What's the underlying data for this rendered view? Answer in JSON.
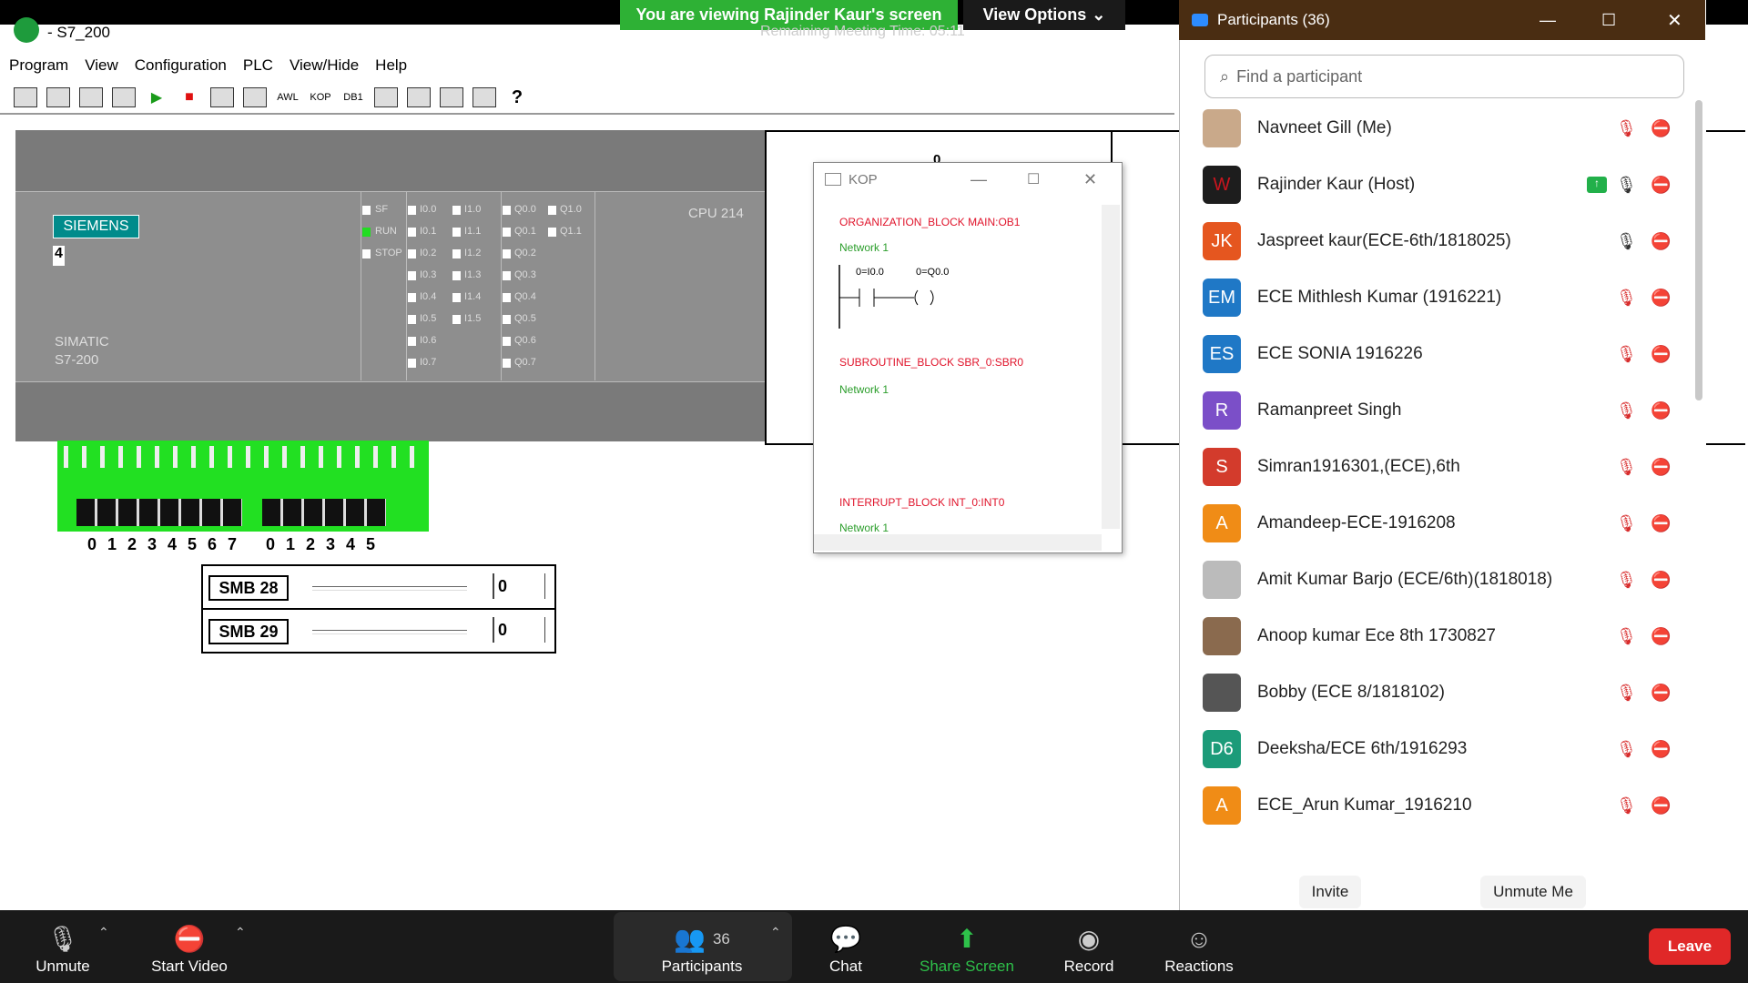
{
  "zoom": {
    "share_banner": "You are viewing Rajinder Kaur's screen",
    "view_options": "View Options",
    "meeting_time": "Remaining Meeting Time: 05:11",
    "leave": "Leave"
  },
  "app": {
    "title": "- S7_200",
    "menu": [
      "Program",
      "View",
      "Configuration",
      "PLC",
      "View/Hide",
      "Help"
    ],
    "toolbar": [
      "AWL",
      "KOP",
      "DB1"
    ]
  },
  "plc": {
    "brand": "SIEMENS",
    "mode_digit": "4",
    "model_line1": "SIMATIC",
    "model_line2": "S7-200",
    "cpu": "CPU 214",
    "status_labels": [
      "SF",
      "RUN",
      "STOP"
    ],
    "run_led_color": "#22dd22",
    "input_labels_a": [
      "I0.0",
      "I0.1",
      "I0.2",
      "I0.3",
      "I0.4",
      "I0.5",
      "I0.6",
      "I0.7"
    ],
    "input_labels_b": [
      "I1.0",
      "I1.1",
      "I1.2",
      "I1.3",
      "I1.4",
      "I1.5"
    ],
    "output_labels_a": [
      "Q0.0",
      "Q0.1",
      "Q0.2",
      "Q0.3",
      "Q0.4",
      "Q0.5",
      "Q0.6",
      "Q0.7"
    ],
    "output_labels_b": [
      "Q1.0",
      "Q1.1"
    ],
    "input_switch_numbers_a": [
      "0",
      "1",
      "2",
      "3",
      "4",
      "5",
      "6",
      "7"
    ],
    "input_switch_numbers_b": [
      "0",
      "1",
      "2",
      "3",
      "4",
      "5"
    ],
    "right_panel_value": "0"
  },
  "smb": [
    {
      "label": "SMB 28",
      "value": "0"
    },
    {
      "label": "SMB 29",
      "value": "0"
    }
  ],
  "kop": {
    "title": "KOP",
    "ob_title": "ORGANIZATION_BLOCK MAIN:OB1",
    "network": "Network 1",
    "contact": "0=I0.0",
    "coil": "0=Q0.0",
    "sbr_title": "SUBROUTINE_BLOCK SBR_0:SBR0",
    "int_title": "INTERRUPT_BLOCK INT_0:INT0"
  },
  "participants": {
    "header": "Participants (36)",
    "search_placeholder": "Find a participant",
    "list": [
      {
        "name": "Navneet Gill (Me)",
        "initials": "",
        "color": "#c9a98a",
        "mic": "muted",
        "cam": "off"
      },
      {
        "name": "Rajinder Kaur (Host)",
        "initials": "W",
        "color": "#1d1d1d",
        "mic": "on",
        "cam": "off",
        "sharing": true
      },
      {
        "name": "Jaspreet kaur(ECE-6th/1818025)",
        "initials": "JK",
        "color": "#e5561f",
        "mic": "on",
        "cam": "off"
      },
      {
        "name": "ECE Mithlesh Kumar (1916221)",
        "initials": "EM",
        "color": "#1f78c6",
        "mic": "muted",
        "cam": "off"
      },
      {
        "name": "ECE SONIA 1916226",
        "initials": "ES",
        "color": "#1f78c6",
        "mic": "muted",
        "cam": "off"
      },
      {
        "name": "Ramanpreet Singh",
        "initials": "R",
        "color": "#7b4fc8",
        "mic": "muted",
        "cam": "off"
      },
      {
        "name": "Simran1916301,(ECE),6th",
        "initials": "S",
        "color": "#d33b2c",
        "mic": "muted",
        "cam": "off"
      },
      {
        "name": "Amandeep-ECE-1916208",
        "initials": "A",
        "color": "#f08c16",
        "mic": "muted",
        "cam": "off"
      },
      {
        "name": "Amit Kumar Barjo (ECE/6th)(1818018)",
        "initials": "",
        "color": "#bbbbbb",
        "mic": "muted",
        "cam": "off"
      },
      {
        "name": "Anoop kumar Ece 8th 1730827",
        "initials": "",
        "color": "#8a6a4e",
        "mic": "muted",
        "cam": "off"
      },
      {
        "name": "Bobby (ECE 8/1818102)",
        "initials": "",
        "color": "#555555",
        "mic": "muted",
        "cam": "off"
      },
      {
        "name": "Deeksha/ECE 6th/1916293",
        "initials": "D6",
        "color": "#1c9b79",
        "mic": "muted",
        "cam": "off"
      },
      {
        "name": "ECE_Arun Kumar_1916210",
        "initials": "A",
        "color": "#f08c16",
        "mic": "muted",
        "cam": "off"
      }
    ],
    "invite": "Invite",
    "unmute_me": "Unmute Me"
  },
  "bottom": {
    "unmute": "Unmute",
    "start_video": "Start Video",
    "participants": "Participants",
    "participants_count": "36",
    "chat": "Chat",
    "share_screen": "Share Screen",
    "record": "Record",
    "reactions": "Reactions"
  }
}
